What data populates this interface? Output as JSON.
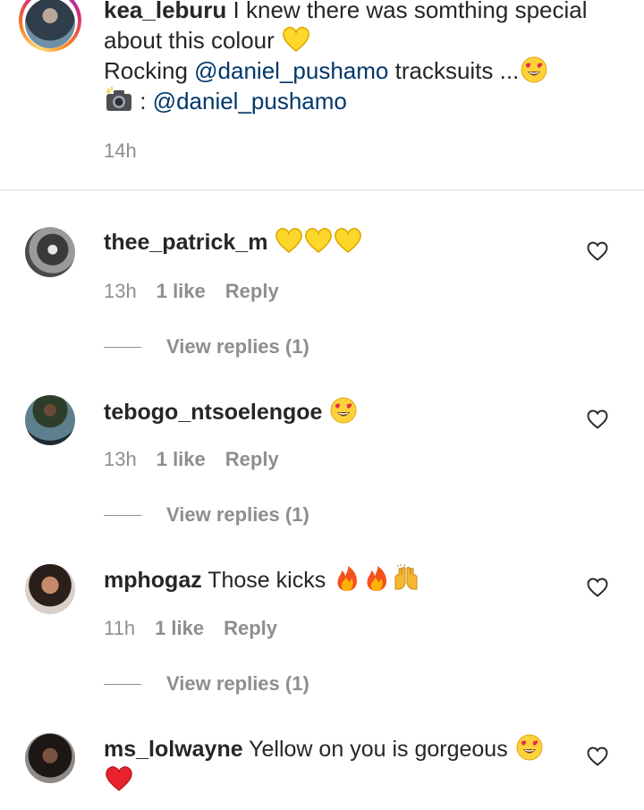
{
  "caption": {
    "username": "kea_leburu",
    "line1": "I knew there was somthing special",
    "line2": "about this colour",
    "line3_prefix": "Rocking ",
    "line3_mention": "@daniel_pushamo",
    "line3_suffix": " tracksuits ...",
    "line4_sep": " : ",
    "line4_mention": "@daniel_pushamo",
    "time": "14h"
  },
  "comments": [
    {
      "username": "thee_patrick_m",
      "text": "",
      "time": "13h",
      "likes": "1 like",
      "reply_label": "Reply",
      "view_replies": "View replies (1)"
    },
    {
      "username": "tebogo_ntsoelengoe",
      "text": "",
      "time": "13h",
      "likes": "1 like",
      "reply_label": "Reply",
      "view_replies": "View replies (1)"
    },
    {
      "username": "mphogaz",
      "text": "Those kicks",
      "time": "11h",
      "likes": "1 like",
      "reply_label": "Reply",
      "view_replies": "View replies (1)"
    },
    {
      "username": "ms_lolwayne",
      "text": "Yellow on you is gorgeous"
    }
  ],
  "icons": {
    "heart": "heart-outline-icon",
    "yellow_heart": "yellow-heart-emoji",
    "heart_eyes": "heart-eyes-emoji",
    "fire": "fire-emoji",
    "raised_hands": "raised-hands-emoji",
    "camera": "camera-flash-emoji",
    "red_heart": "red-heart-emoji"
  },
  "colors": {
    "text": "#262626",
    "secondary": "#8e8e8e",
    "mention": "#00376b",
    "divider": "#dbdbdb"
  }
}
